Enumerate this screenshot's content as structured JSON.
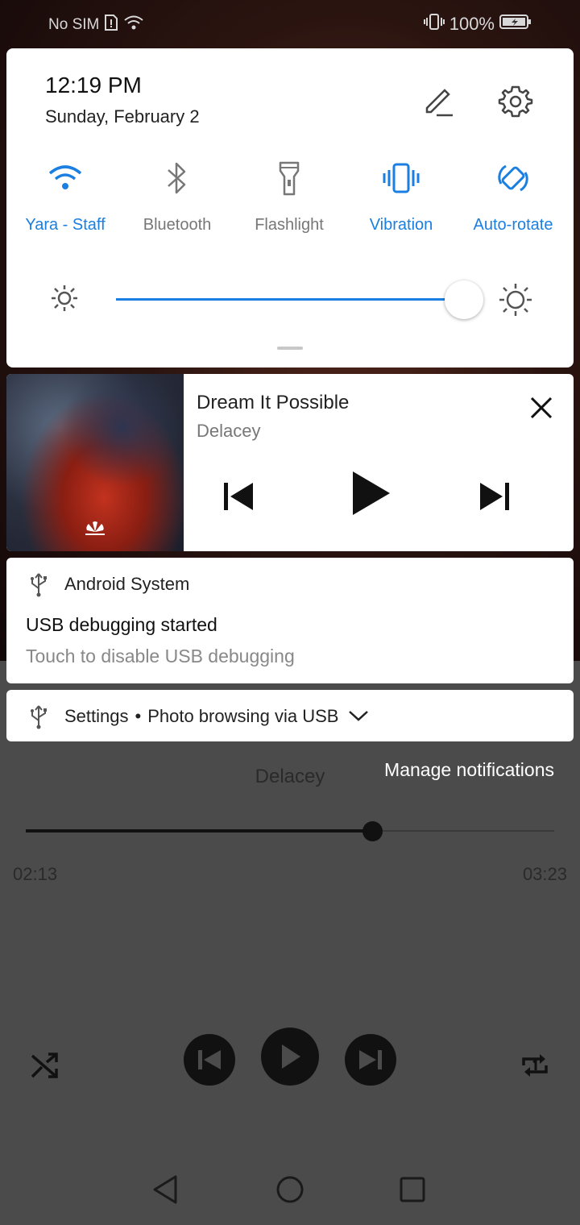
{
  "status_bar": {
    "carrier": "No SIM",
    "battery": "100%"
  },
  "quick_settings": {
    "time": "12:19 PM",
    "date": "Sunday, February 2",
    "tiles": [
      {
        "label": "Yara - Staff",
        "icon": "wifi-icon",
        "active": true
      },
      {
        "label": "Bluetooth",
        "icon": "bluetooth-icon",
        "active": false
      },
      {
        "label": "Flashlight",
        "icon": "flashlight-icon",
        "active": false
      },
      {
        "label": "Vibration",
        "icon": "vibration-icon",
        "active": true
      },
      {
        "label": "Auto-rotate",
        "icon": "auto-rotate-icon",
        "active": true
      }
    ],
    "brightness": 0.95,
    "accent_color": "#1a7fe0"
  },
  "media": {
    "song": "Dream It Possible",
    "artist": "Delacey"
  },
  "notification": {
    "app": "Android System",
    "title": "USB debugging started",
    "body": "Touch to disable USB debugging"
  },
  "notification2": {
    "app": "Settings",
    "separator": "•",
    "text": "Photo browsing via USB"
  },
  "background_player": {
    "artist": "Delacey",
    "manage_label": "Manage notifications",
    "elapsed": "02:13",
    "duration": "03:23",
    "progress": 0.655
  }
}
